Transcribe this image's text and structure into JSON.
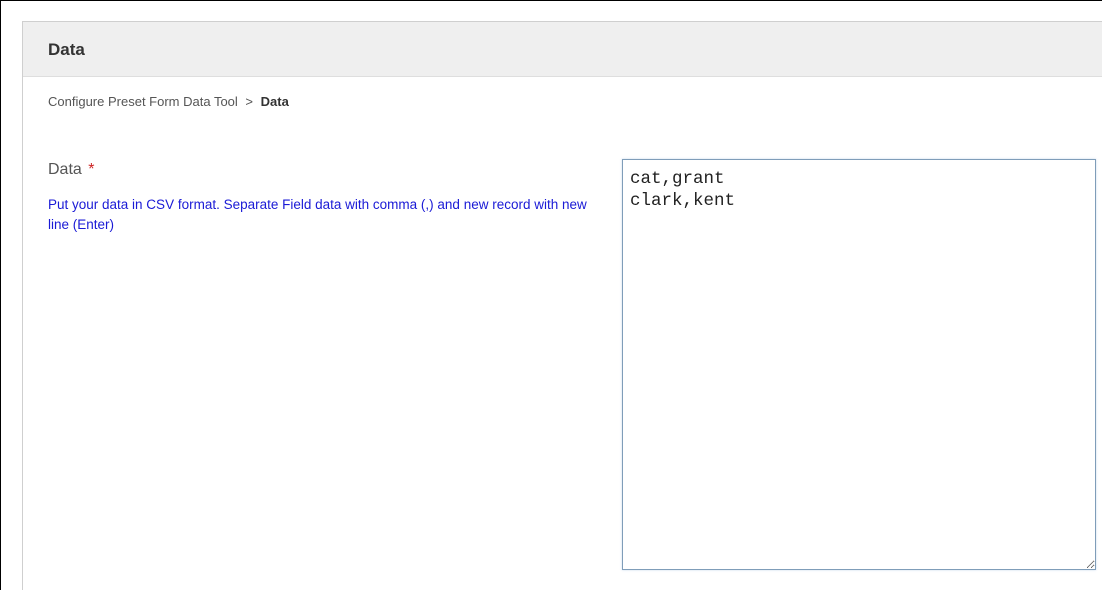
{
  "panel": {
    "title": "Data"
  },
  "breadcrumb": {
    "parent": "Configure Preset Form Data Tool",
    "separator": ">",
    "current": "Data"
  },
  "field": {
    "label": "Data",
    "required_marker": "*",
    "help_text": "Put your data in CSV format. Separate Field data with comma (,) and new record with new line (Enter)",
    "value": "cat,grant\nclark,kent"
  },
  "colors": {
    "header_bg": "#efefef",
    "help_text": "#1a1ad6",
    "required": "#cc2222",
    "textarea_border": "#7f9db9"
  }
}
